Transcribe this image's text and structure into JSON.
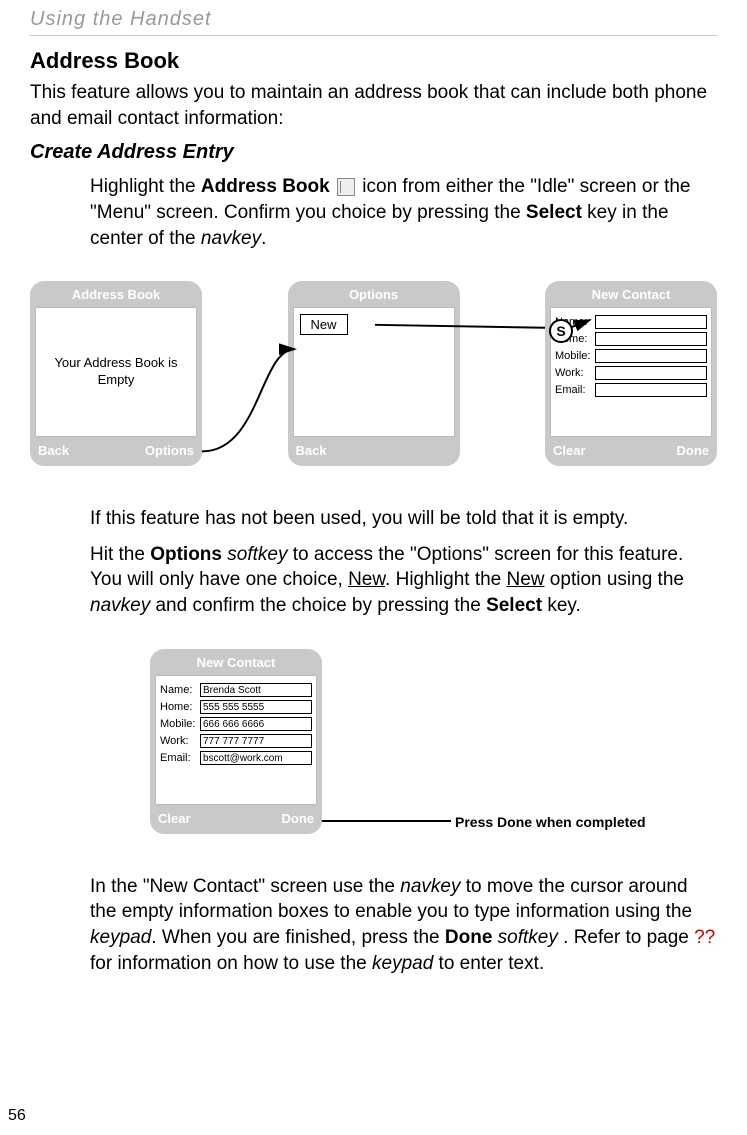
{
  "header": "Using the Handset",
  "h1": "Address Book",
  "intro": "This feature allows you to maintain an address book that can include both phone and email contact information:",
  "h2": "Create Address Entry",
  "para1_a": "Highlight the ",
  "para1_b": "Address Book",
  "para1_c": " icon from either the \"Idle\" screen or the \"Menu\" screen. Confirm you choice by pressing the ",
  "para1_d": "Select",
  "para1_e": " key in the center of the ",
  "para1_f": "navkey",
  "para1_g": ".",
  "screens": {
    "s1": {
      "title": "Address Book",
      "body": "Your Address Book is Empty",
      "left": "Back",
      "right": "Options"
    },
    "s2": {
      "title": "Options",
      "item": "New",
      "left": "Back",
      "right": ""
    },
    "s3": {
      "title": "New Contact",
      "left": "Clear",
      "right": "Done",
      "fields": {
        "name_l": "Name:",
        "home_l": "Home:",
        "mobile_l": "Mobile:",
        "work_l": "Work:",
        "email_l": "Email:",
        "name_v": "",
        "home_v": "",
        "mobile_v": "",
        "work_v": "",
        "email_v": ""
      }
    }
  },
  "s_badge": "S",
  "para2": "If this feature has not been used, you will be told that it is empty.",
  "para3_a": "Hit the ",
  "para3_b": "Options",
  "para3_c": " softkey",
  "para3_d": " to access the \"Options\" screen for this feature. You will only have one choice, ",
  "para3_e": "New",
  "para3_f": ". Highlight the ",
  "para3_g": "New",
  "para3_h": " option using the ",
  "para3_i": "navkey",
  "para3_j": " and confirm the choice by pressing the ",
  "para3_k": "Select",
  "para3_l": " key.",
  "screen4": {
    "title": "New Contact",
    "left": "Clear",
    "right": "Done",
    "fields": {
      "name_l": "Name:",
      "home_l": "Home:",
      "mobile_l": "Mobile:",
      "work_l": "Work:",
      "email_l": "Email:",
      "name_v": "Brenda Scott",
      "home_v": "555 555 5555",
      "mobile_v": "666 666 6666",
      "work_v": "777 777 7777",
      "email_v": "bscott@work.com"
    }
  },
  "done_callout": "Press Done when completed",
  "para4_a": "In the \"New Contact\" screen use the ",
  "para4_b": "navkey",
  "para4_c": " to move the cursor around the empty information boxes to enable you to type information using the ",
  "para4_d": "keypad",
  "para4_e": ". When you are finished, press the ",
  "para4_f": "Done",
  "para4_g": " softkey ",
  "para4_h": ". Refer to page ",
  "para4_i": "??",
  "para4_j": " for information on how to use the ",
  "para4_k": "keypad",
  "para4_l": " to enter text.",
  "page_num": "56"
}
